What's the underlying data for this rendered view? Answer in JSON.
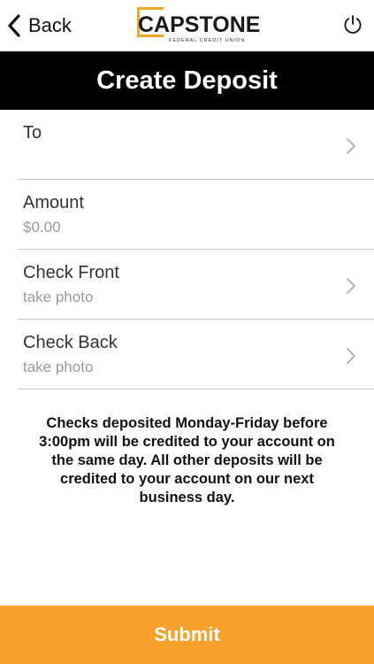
{
  "nav": {
    "back_label": "Back",
    "logo_cap": "CAP",
    "logo_stone": "STONE",
    "logo_sub": "FEDERAL CREDIT UNION"
  },
  "title": "Create Deposit",
  "form": {
    "rows": [
      {
        "label": "To",
        "value": ""
      },
      {
        "label": "Amount",
        "value": "$0.00"
      },
      {
        "label": "Check Front",
        "value": "take photo"
      },
      {
        "label": "Check Back",
        "value": "take photo"
      }
    ]
  },
  "notice": "Checks deposited Monday-Friday before 3:00pm will be credited to your account on the same day. All other deposits will be credited to your account on our next business day.",
  "submit_label": "Submit",
  "colors": {
    "accent": "#f7a12b",
    "title_bar": "#000000",
    "secondary_text": "#9a9a9a"
  },
  "icons": [
    "chevron-left-icon",
    "power-icon",
    "chevron-right-icon"
  ]
}
